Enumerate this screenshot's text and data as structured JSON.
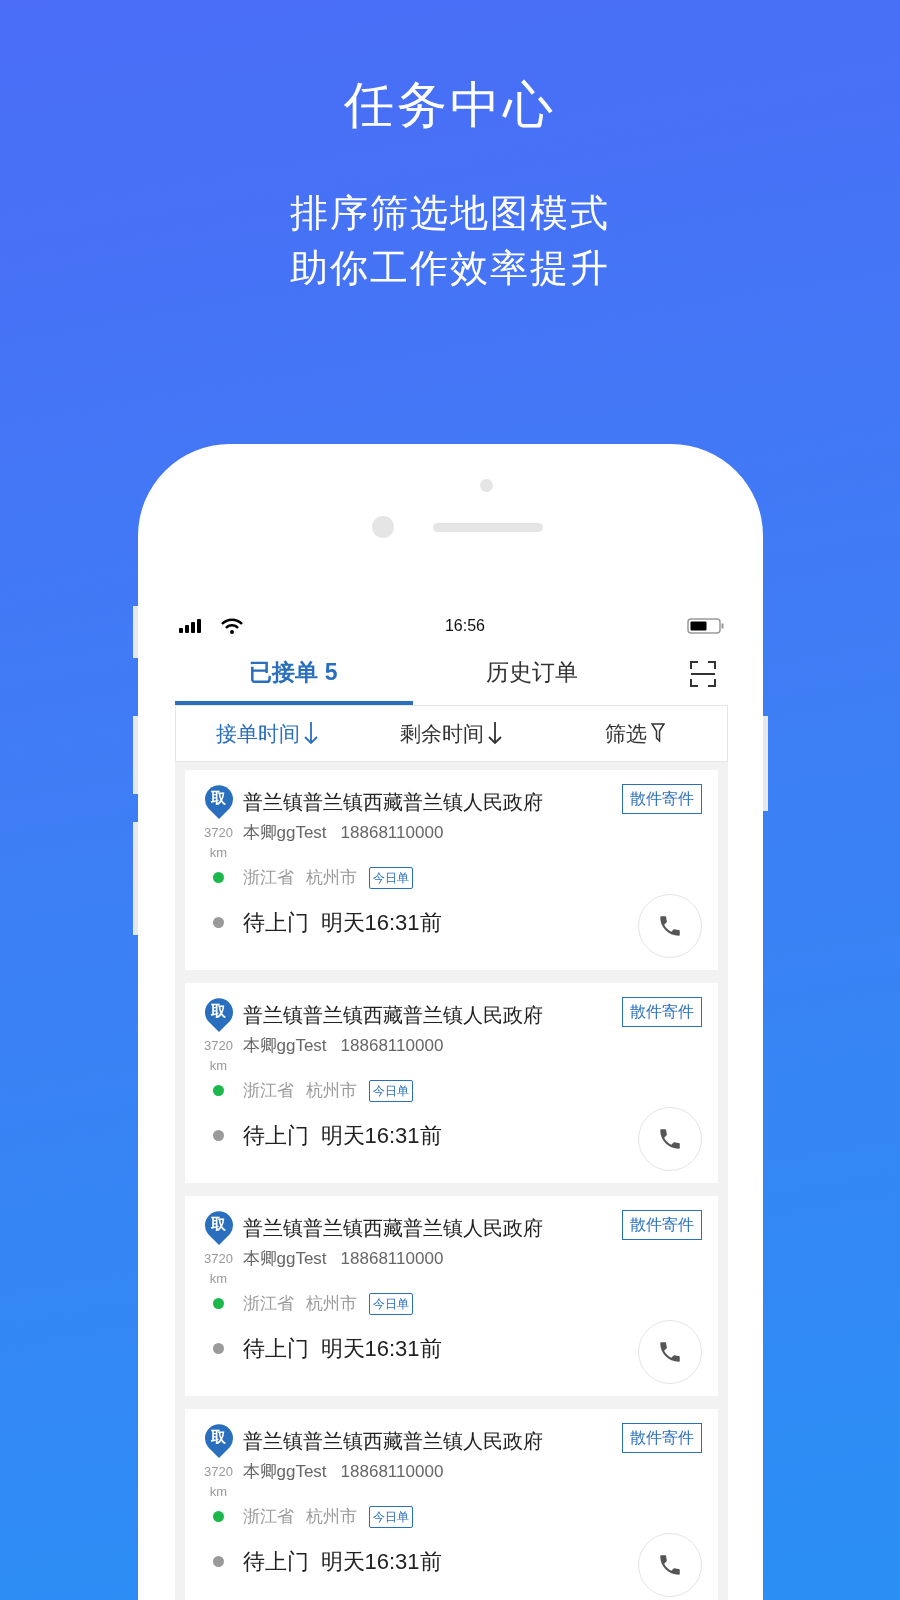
{
  "headline": {
    "title": "任务中心",
    "lines": [
      "排序筛选地图模式",
      "助你工作效率提升"
    ]
  },
  "status_bar": {
    "time": "16:56"
  },
  "tabs": [
    {
      "label": "已接单 5",
      "selected": true
    },
    {
      "label": "历史订单",
      "selected": false
    }
  ],
  "sort_bar": [
    {
      "label": "接单时间",
      "kind": "sort",
      "selected": true
    },
    {
      "label": "剩余时间",
      "kind": "sort",
      "selected": false
    },
    {
      "label": "筛选",
      "kind": "filter",
      "selected": false
    }
  ],
  "orders": [
    {
      "pin": "取",
      "distance": "3720",
      "unit": "km",
      "address": "普兰镇普兰镇西藏普兰镇人民政府",
      "tag": "散件寄件",
      "contact": "本卿ggTest",
      "phone": "18868110000",
      "province": "浙江省",
      "city": "杭州市",
      "badge": "今日单",
      "status": "待上门",
      "deadline": "明天16:31前"
    },
    {
      "pin": "取",
      "distance": "3720",
      "unit": "km",
      "address": "普兰镇普兰镇西藏普兰镇人民政府",
      "tag": "散件寄件",
      "contact": "本卿ggTest",
      "phone": "18868110000",
      "province": "浙江省",
      "city": "杭州市",
      "badge": "今日单",
      "status": "待上门",
      "deadline": "明天16:31前"
    },
    {
      "pin": "取",
      "distance": "3720",
      "unit": "km",
      "address": "普兰镇普兰镇西藏普兰镇人民政府",
      "tag": "散件寄件",
      "contact": "本卿ggTest",
      "phone": "18868110000",
      "province": "浙江省",
      "city": "杭州市",
      "badge": "今日单",
      "status": "待上门",
      "deadline": "明天16:31前"
    },
    {
      "pin": "取",
      "distance": "3720",
      "unit": "km",
      "address": "普兰镇普兰镇西藏普兰镇人民政府",
      "tag": "散件寄件",
      "contact": "本卿ggTest",
      "phone": "18868110000",
      "province": "浙江省",
      "city": "杭州市",
      "badge": "今日单",
      "status": "待上门",
      "deadline": "明天16:31前"
    }
  ]
}
